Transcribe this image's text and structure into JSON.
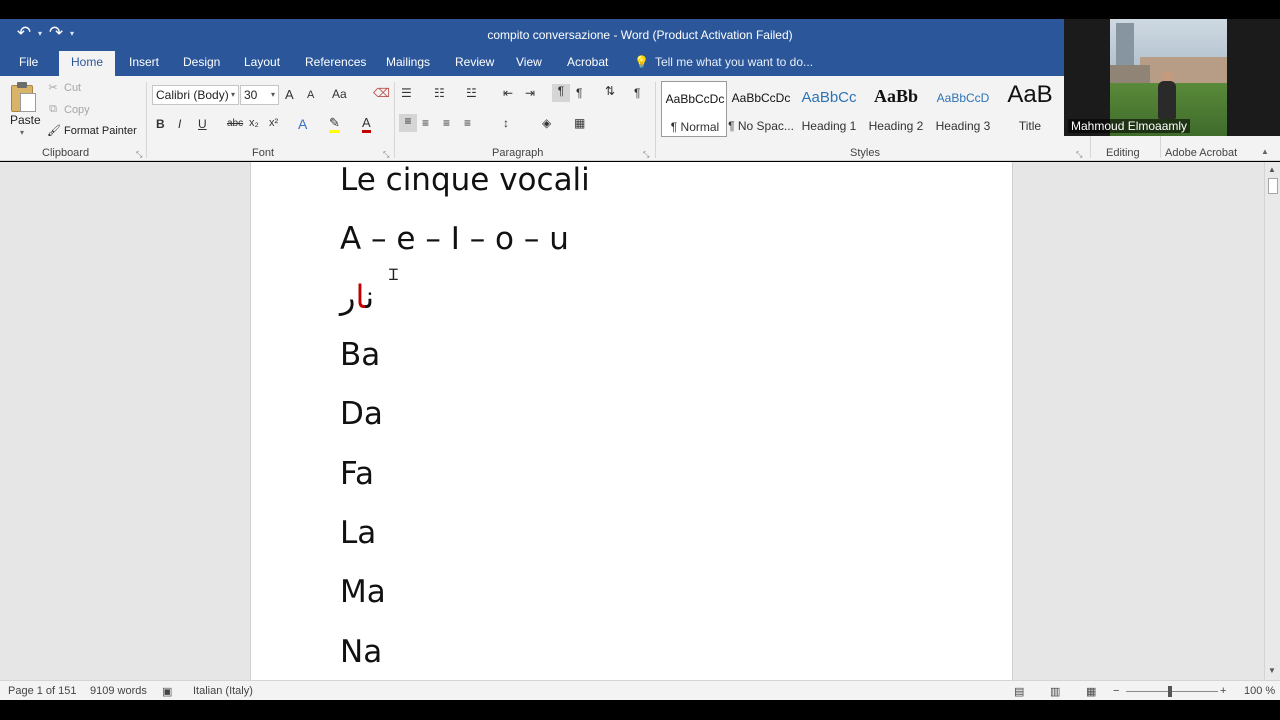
{
  "window": {
    "title": "compito conversazione - Word (Product Activation Failed)"
  },
  "quick_access": {
    "undo_icon": "undo-icon",
    "redo_icon": "redo-icon",
    "customize_icon": "customize-qat-icon"
  },
  "tabs": [
    {
      "label": "File"
    },
    {
      "label": "Home"
    },
    {
      "label": "Insert"
    },
    {
      "label": "Design"
    },
    {
      "label": "Layout"
    },
    {
      "label": "References"
    },
    {
      "label": "Mailings"
    },
    {
      "label": "Review"
    },
    {
      "label": "View"
    },
    {
      "label": "Acrobat"
    }
  ],
  "tell_me": {
    "text": "Tell me what you want to do..."
  },
  "clipboard": {
    "paste": "Paste",
    "cut": "Cut",
    "copy": "Copy",
    "format_painter": "Format Painter",
    "group": "Clipboard"
  },
  "font": {
    "name": "Calibri (Body)",
    "size": "30",
    "group": "Font",
    "grow": "A",
    "shrink": "A",
    "case": "Aa",
    "bold": "B",
    "italic": "I",
    "underline": "U",
    "strike": "abc",
    "sub": "x₂",
    "sup": "x²",
    "color_a": "A"
  },
  "paragraph": {
    "group": "Paragraph"
  },
  "styles": {
    "group": "Styles",
    "items": [
      {
        "preview": "AaBbCcDc",
        "name": "¶ Normal"
      },
      {
        "preview": "AaBbCcDc",
        "name": "¶ No Spac..."
      },
      {
        "preview": "AaBbCc",
        "name": "Heading 1"
      },
      {
        "preview": "AaBb",
        "name": "Heading 2"
      },
      {
        "preview": "AaBbCcD",
        "name": "Heading 3"
      },
      {
        "preview": "AaB",
        "name": "Title"
      }
    ]
  },
  "editing": {
    "group": "Editing"
  },
  "adobe": {
    "group": "Adobe Acrobat"
  },
  "video": {
    "participant": "Mahmoud Elmoaamly"
  },
  "document": {
    "lines": [
      "Le cinque vocali",
      "A – e – I – o – u",
      "Ba",
      "Da",
      "Fa",
      "La",
      "Ma",
      "Na"
    ],
    "arabic_black": "ن",
    "arabic_red": "ا",
    "arabic_black2": "ر"
  },
  "status": {
    "page": "Page 1 of 151",
    "words": "9109 words",
    "language": "Italian (Italy)",
    "zoom": "100 %"
  },
  "colors": {
    "word_blue": "#2b579a",
    "ribbon": "#f3f3f3",
    "canvas": "#e6e6e6",
    "highlight": "#ffff00",
    "font_red": "#c00000"
  }
}
